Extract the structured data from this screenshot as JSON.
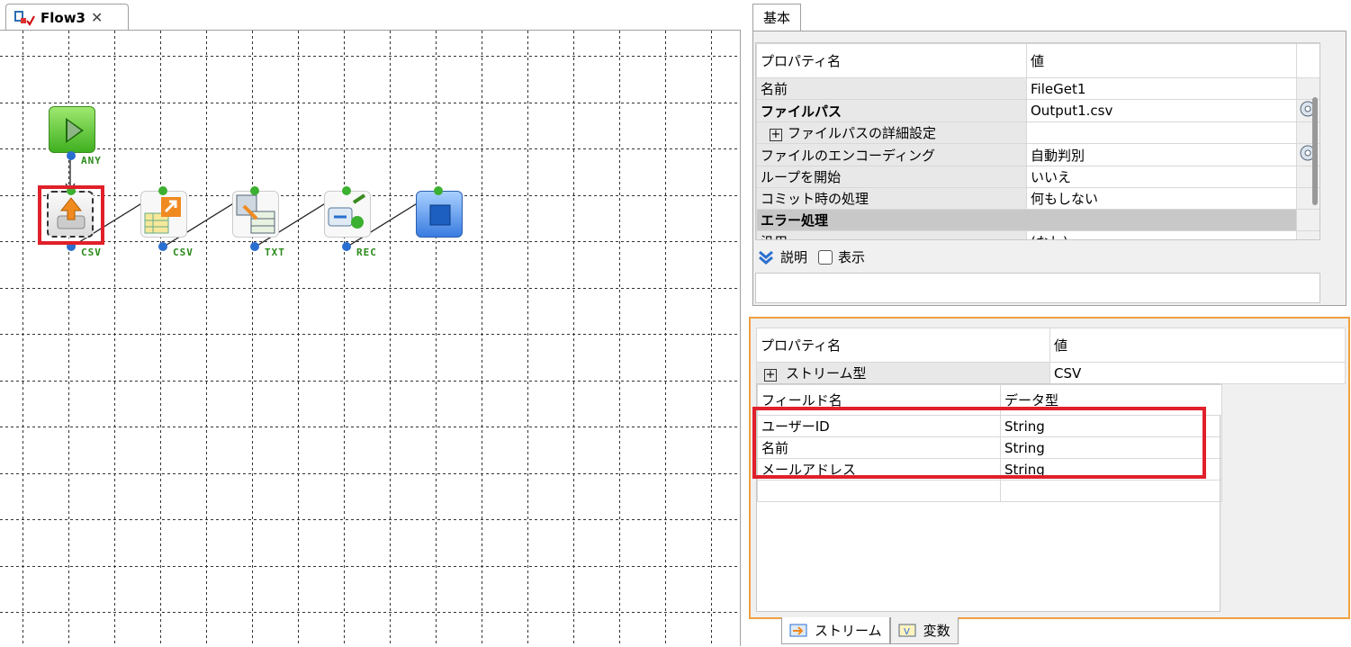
{
  "editor": {
    "tab_title": "Flow3",
    "tab_close": "✕"
  },
  "flow": {
    "ports": {
      "any": "ANY",
      "csv1": "CSV",
      "csv2": "CSV",
      "txt": "TXT",
      "rec": "REC"
    }
  },
  "top_panel": {
    "tab": "基本",
    "header": {
      "name": "プロパティ名",
      "value": "値"
    },
    "rows": [
      {
        "name": "名前",
        "value": "FileGet1"
      },
      {
        "name": "ファイルパス",
        "value": "Output1.csv"
      },
      {
        "name": "ファイルパスの詳細設定",
        "value": ""
      },
      {
        "name": "ファイルのエンコーディング",
        "value": "自動判別"
      },
      {
        "name": "ループを開始",
        "value": "いいえ"
      },
      {
        "name": "コミット時の処理",
        "value": "何もしない"
      },
      {
        "name": "エラー処理",
        "value": ""
      },
      {
        "name": "汎用",
        "value": "(なし)"
      }
    ],
    "description_label": "説明",
    "show_label": "表示"
  },
  "bottom_panel": {
    "header": {
      "name": "プロパティ名",
      "value": "値"
    },
    "stream_type": {
      "name": "ストリーム型",
      "value": "CSV"
    },
    "fields_header": {
      "field": "フィールド名",
      "type": "データ型"
    },
    "fields": [
      {
        "field": "ユーザーID",
        "type": "String"
      },
      {
        "field": "名前",
        "type": "String"
      },
      {
        "field": "メールアドレス",
        "type": "String"
      }
    ],
    "tabs": [
      "ストリーム",
      "変数"
    ]
  },
  "colors": {
    "highlight": "#e0202a",
    "panel_border": "#f0a040"
  }
}
